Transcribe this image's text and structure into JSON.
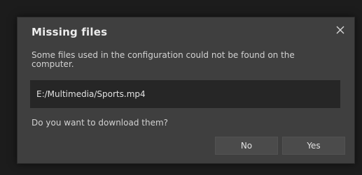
{
  "dialog": {
    "title": "Missing files",
    "close_icon": "close-icon",
    "message": "Some files used in the configuration could not be found on the computer.",
    "missing_file_path": "E:/Multimedia/Sports.mp4",
    "question": "Do you want to download them?",
    "buttons": {
      "no_label": "No",
      "yes_label": "Yes"
    }
  },
  "colors": {
    "dialog_bg": "#3f3f3f",
    "path_box_bg": "#262626",
    "button_bg": "#4b4b4b",
    "text": "#d2d2d2"
  }
}
